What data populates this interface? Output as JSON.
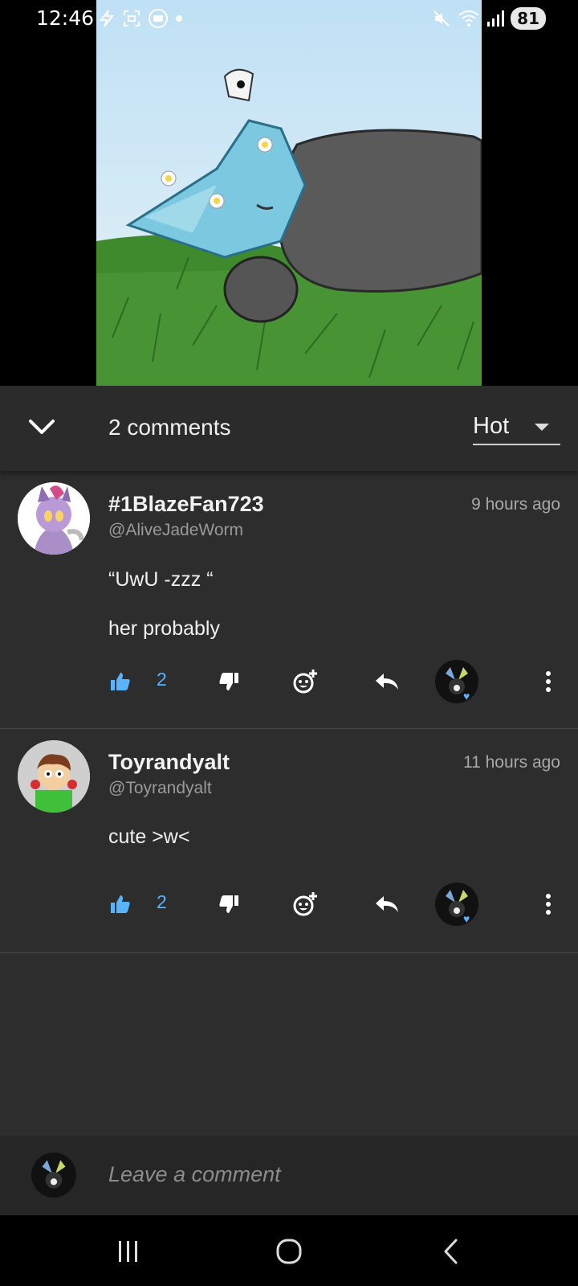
{
  "status_bar": {
    "time": "12:46",
    "battery": "81",
    "icons_left": [
      "bolt-icon",
      "screenshot-icon",
      "media-icon",
      "dot-icon"
    ],
    "icons_right": [
      "mute-icon",
      "wifi-icon",
      "signal-icon"
    ]
  },
  "header": {
    "count_label": "2 comments",
    "sort": {
      "selected": "Hot"
    }
  },
  "comments": [
    {
      "author": "#1BlazeFan723",
      "handle": "@AliveJadeWorm",
      "time": "9 hours ago",
      "lines": [
        "“UwU -zzz “",
        "her probably"
      ],
      "likes": "2"
    },
    {
      "author": "Toyrandyalt",
      "handle": "@Toyrandyalt",
      "time": "11 hours ago",
      "lines": [
        "cute >w<"
      ],
      "likes": "2"
    }
  ],
  "composer": {
    "placeholder": "Leave a comment"
  },
  "colors": {
    "accent": "#58b4ff",
    "panel": "#2d2d2d",
    "header": "#2b2b2b"
  }
}
